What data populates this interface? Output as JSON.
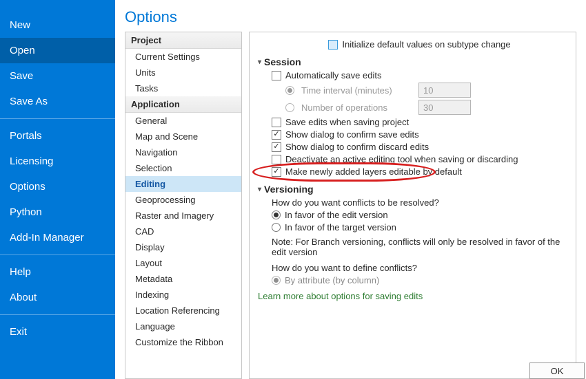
{
  "filemenu": {
    "items": [
      {
        "label": "New"
      },
      {
        "label": "Open",
        "selected": true
      },
      {
        "label": "Save"
      },
      {
        "label": "Save As"
      },
      {
        "sep": true
      },
      {
        "label": "Portals"
      },
      {
        "label": "Licensing"
      },
      {
        "label": "Options"
      },
      {
        "label": "Python"
      },
      {
        "label": "Add-In Manager"
      },
      {
        "sep": true
      },
      {
        "label": "Help"
      },
      {
        "label": "About"
      },
      {
        "sep": true
      },
      {
        "label": "Exit"
      }
    ]
  },
  "page_title": "Options",
  "categories": {
    "group1_header": "Project",
    "group1_items": [
      "Current Settings",
      "Units",
      "Tasks"
    ],
    "group2_header": "Application",
    "group2_items": [
      "General",
      "Map and Scene",
      "Navigation",
      "Selection",
      "Editing",
      "Geoprocessing",
      "Raster and Imagery",
      "CAD",
      "Display",
      "Layout",
      "Metadata",
      "Indexing",
      "Location Referencing",
      "Language",
      "Customize the Ribbon"
    ],
    "selected": "Editing"
  },
  "top_checkbox_label": "Initialize default values on subtype change",
  "session": {
    "header": "Session",
    "auto_save_label": "Automatically save edits",
    "time_interval_label": "Time interval (minutes)",
    "time_interval_value": "10",
    "num_ops_label": "Number of operations",
    "num_ops_value": "30",
    "save_on_save_label": "Save edits when saving project",
    "confirm_save_label": "Show dialog to confirm save edits",
    "confirm_discard_label": "Show dialog to confirm discard edits",
    "deactivate_tool_label": "Deactivate an active editing tool when saving or discarding",
    "make_editable_label": "Make newly added layers editable by default"
  },
  "versioning": {
    "header": "Versioning",
    "q1": "How do you want conflicts to be resolved?",
    "opt1": "In favor of the edit version",
    "opt2": "In favor of the target version",
    "note": "Note: For Branch versioning, conflicts will only be resolved in favor of the edit version",
    "q2": "How do you want to define conflicts?",
    "opt3": "By attribute (by column)"
  },
  "learn_more": "Learn more about options for saving edits",
  "ok_label": "OK"
}
